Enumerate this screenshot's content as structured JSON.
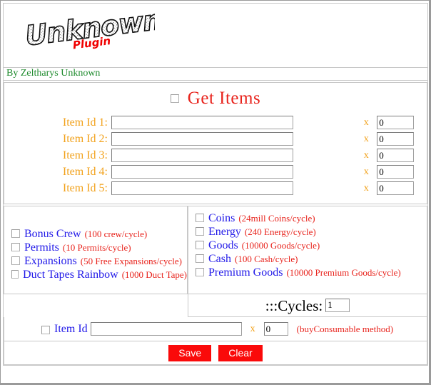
{
  "header": {
    "logo_text": "Unknown",
    "logo_badge": "Plugin",
    "byline": "By Zeltharys Unknown"
  },
  "get_items": {
    "title": "Get Items",
    "checkbox_name": "get-items-checkbox",
    "rows": [
      {
        "label": "Item Id 1:",
        "id_value": "",
        "separator": "x",
        "qty_value": "0"
      },
      {
        "label": "Item Id 2:",
        "id_value": "",
        "separator": "x",
        "qty_value": "0"
      },
      {
        "label": "Item Id 3:",
        "id_value": "",
        "separator": "x",
        "qty_value": "0"
      },
      {
        "label": "Item Id 4:",
        "id_value": "",
        "separator": "x",
        "qty_value": "0"
      },
      {
        "label": "Item Id 5:",
        "id_value": "",
        "separator": "x",
        "qty_value": "0"
      }
    ]
  },
  "left_options": [
    {
      "name": "Bonus Crew",
      "rate": "(100 crew/cycle)"
    },
    {
      "name": "Permits",
      "rate": "(10 Permits/cycle)"
    },
    {
      "name": "Expansions",
      "rate": "(50 Free Expansions/cycle)"
    },
    {
      "name": "Duct Tapes Rainbow",
      "rate": "(1000 Duct Tape)"
    }
  ],
  "right_options": [
    {
      "name": "Coins",
      "rate": "(24mill Coins/cycle)"
    },
    {
      "name": "Energy",
      "rate": "(240 Energy/cycle)"
    },
    {
      "name": "Goods",
      "rate": "(10000 Goods/cycle)"
    },
    {
      "name": "Cash",
      "rate": "(100 Cash/cycle)"
    },
    {
      "name": "Premium Goods",
      "rate": "(10000 Premium Goods/cycle)"
    }
  ],
  "cycles": {
    "label": ":::Cycles:",
    "value": "1"
  },
  "consumable": {
    "label": "Item Id",
    "id_value": "",
    "separator": "x",
    "qty_value": "0",
    "method_note": "(buyConsumable method)"
  },
  "footer": {
    "save_label": "Save",
    "clear_label": "Clear"
  },
  "colors": {
    "title_red": "#e8231c",
    "label_orange": "#f2a21c",
    "option_blue": "#2119e8",
    "byline_green": "#1f8b2e",
    "button_red": "#fa0a0a"
  }
}
